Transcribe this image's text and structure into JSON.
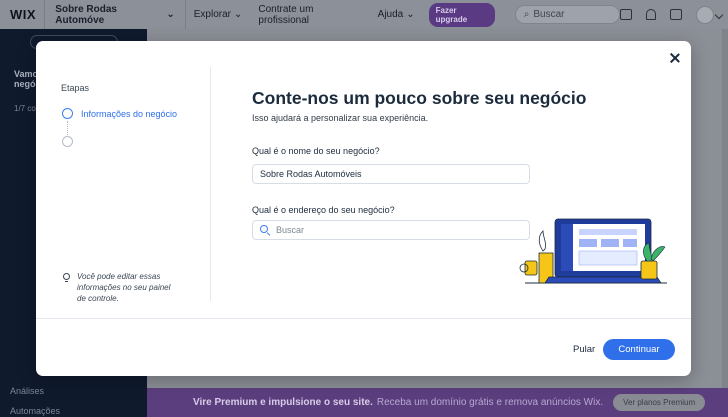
{
  "topbar": {
    "logo": "WIX",
    "site_name": "Sobre Rodas Automóve",
    "nav": [
      "Explorar",
      "Contrate um profissional",
      "Ajuda"
    ],
    "upgrade_label": "Fazer upgrade",
    "search_placeholder": "Buscar"
  },
  "sidebar": {
    "vamos": "Vamo",
    "negoc": "negóc",
    "progress": "1/7 co",
    "analises": "Análises",
    "automacoes": "Automações"
  },
  "promo": {
    "bold": "Vire Premium e impulsione o seu site.",
    "text": "Receba um domínio grátis e remova anúncios Wix.",
    "button": "Ver planos Premium"
  },
  "modal": {
    "steps_title": "Etapas",
    "steps": [
      {
        "label": "Informações do negócio",
        "active": true
      },
      {
        "label": "",
        "active": false
      }
    ],
    "tip": "Você pode editar essas informações no seu painel de controle.",
    "heading": "Conte-nos um pouco sobre seu negócio",
    "subheading": "Isso ajudará a personalizar sua experiência.",
    "name_question": "Qual é o nome do seu negócio?",
    "name_value": "Sobre Rodas Automóveis",
    "address_question": "Qual é o endereço do seu negócio?",
    "address_placeholder": "Buscar",
    "skip_label": "Pular",
    "continue_label": "Continuar"
  },
  "colors": {
    "accent": "#2f6fea",
    "sidebar_bg": "#0f1a2d",
    "promo_bg": "#5b3e7e"
  }
}
